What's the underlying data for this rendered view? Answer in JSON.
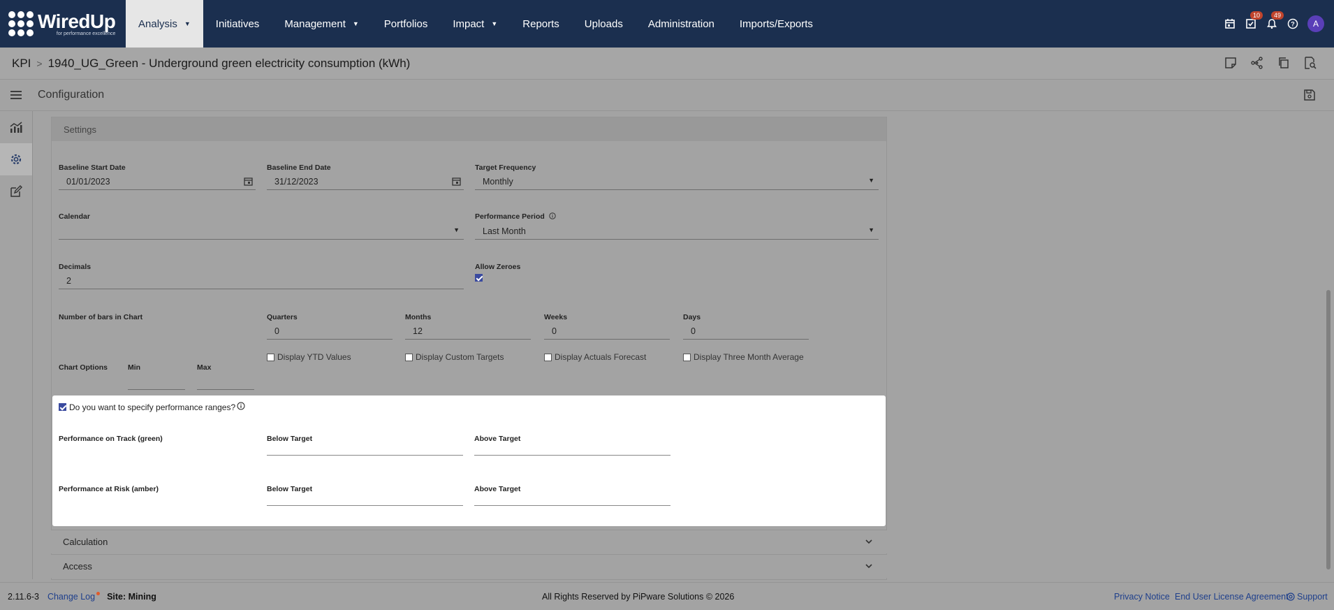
{
  "app": {
    "logo_text": "WiredUp",
    "logo_tagline": "for performance excellence"
  },
  "nav": {
    "items": [
      {
        "label": "Analysis",
        "has_caret": true,
        "active": true
      },
      {
        "label": "Initiatives",
        "has_caret": false
      },
      {
        "label": "Management",
        "has_caret": true
      },
      {
        "label": "Portfolios",
        "has_caret": false
      },
      {
        "label": "Impact",
        "has_caret": true
      },
      {
        "label": "Reports",
        "has_caret": false
      },
      {
        "label": "Uploads",
        "has_caret": false
      },
      {
        "label": "Administration",
        "has_caret": false
      },
      {
        "label": "Imports/Exports",
        "has_caret": false
      }
    ],
    "tasks_badge": "10",
    "notifications_badge": "49",
    "avatar_initial": "A",
    "icons": [
      "calendar-icon",
      "tasks-icon",
      "bell-icon",
      "help-icon"
    ]
  },
  "breadcrumb": {
    "root": "KPI",
    "title": "1940_UG_Green - Underground green electricity consumption (kWh)"
  },
  "config": {
    "title": "Configuration"
  },
  "settings": {
    "section_title": "Settings",
    "baseline_start": {
      "label": "Baseline Start Date",
      "value": "01/01/2023"
    },
    "baseline_end": {
      "label": "Baseline End Date",
      "value": "31/12/2023"
    },
    "target_frequency": {
      "label": "Target Frequency",
      "value": "Monthly"
    },
    "calendar": {
      "label": "Calendar",
      "value": ""
    },
    "performance_period": {
      "label": "Performance Period",
      "value": "Last Month"
    },
    "decimals": {
      "label": "Decimals",
      "value": "2"
    },
    "allow_zeroes": {
      "label": "Allow Zeroes",
      "checked": true
    },
    "bars_label": "Number of bars in Chart",
    "quarters": {
      "label": "Quarters",
      "value": "0"
    },
    "months": {
      "label": "Months",
      "value": "12"
    },
    "weeks": {
      "label": "Weeks",
      "value": "0"
    },
    "days": {
      "label": "Days",
      "value": "0"
    },
    "display_ytd": "Display YTD Values",
    "display_custom_targets": "Display Custom Targets",
    "display_actuals_forecast": "Display Actuals Forecast",
    "display_three_month": "Display Three Month Average",
    "chart_options_label": "Chart Options",
    "min_label": "Min",
    "max_label": "Max"
  },
  "ranges": {
    "question": "Do you want to specify performance ranges?",
    "checked": true,
    "on_track_label": "Performance on Track (green)",
    "at_risk_label": "Performance at Risk (amber)",
    "below_target": "Below Target",
    "above_target": "Above Target"
  },
  "accordions": {
    "calculation": "Calculation",
    "access": "Access"
  },
  "footer": {
    "version": "2.11.6-3",
    "change_log": "Change Log",
    "site": "Site: Mining",
    "copyright": "All Rights Reserved by PiPware Solutions © 2026",
    "privacy": "Privacy Notice",
    "eula": "End User License Agreement",
    "support": "Support"
  }
}
